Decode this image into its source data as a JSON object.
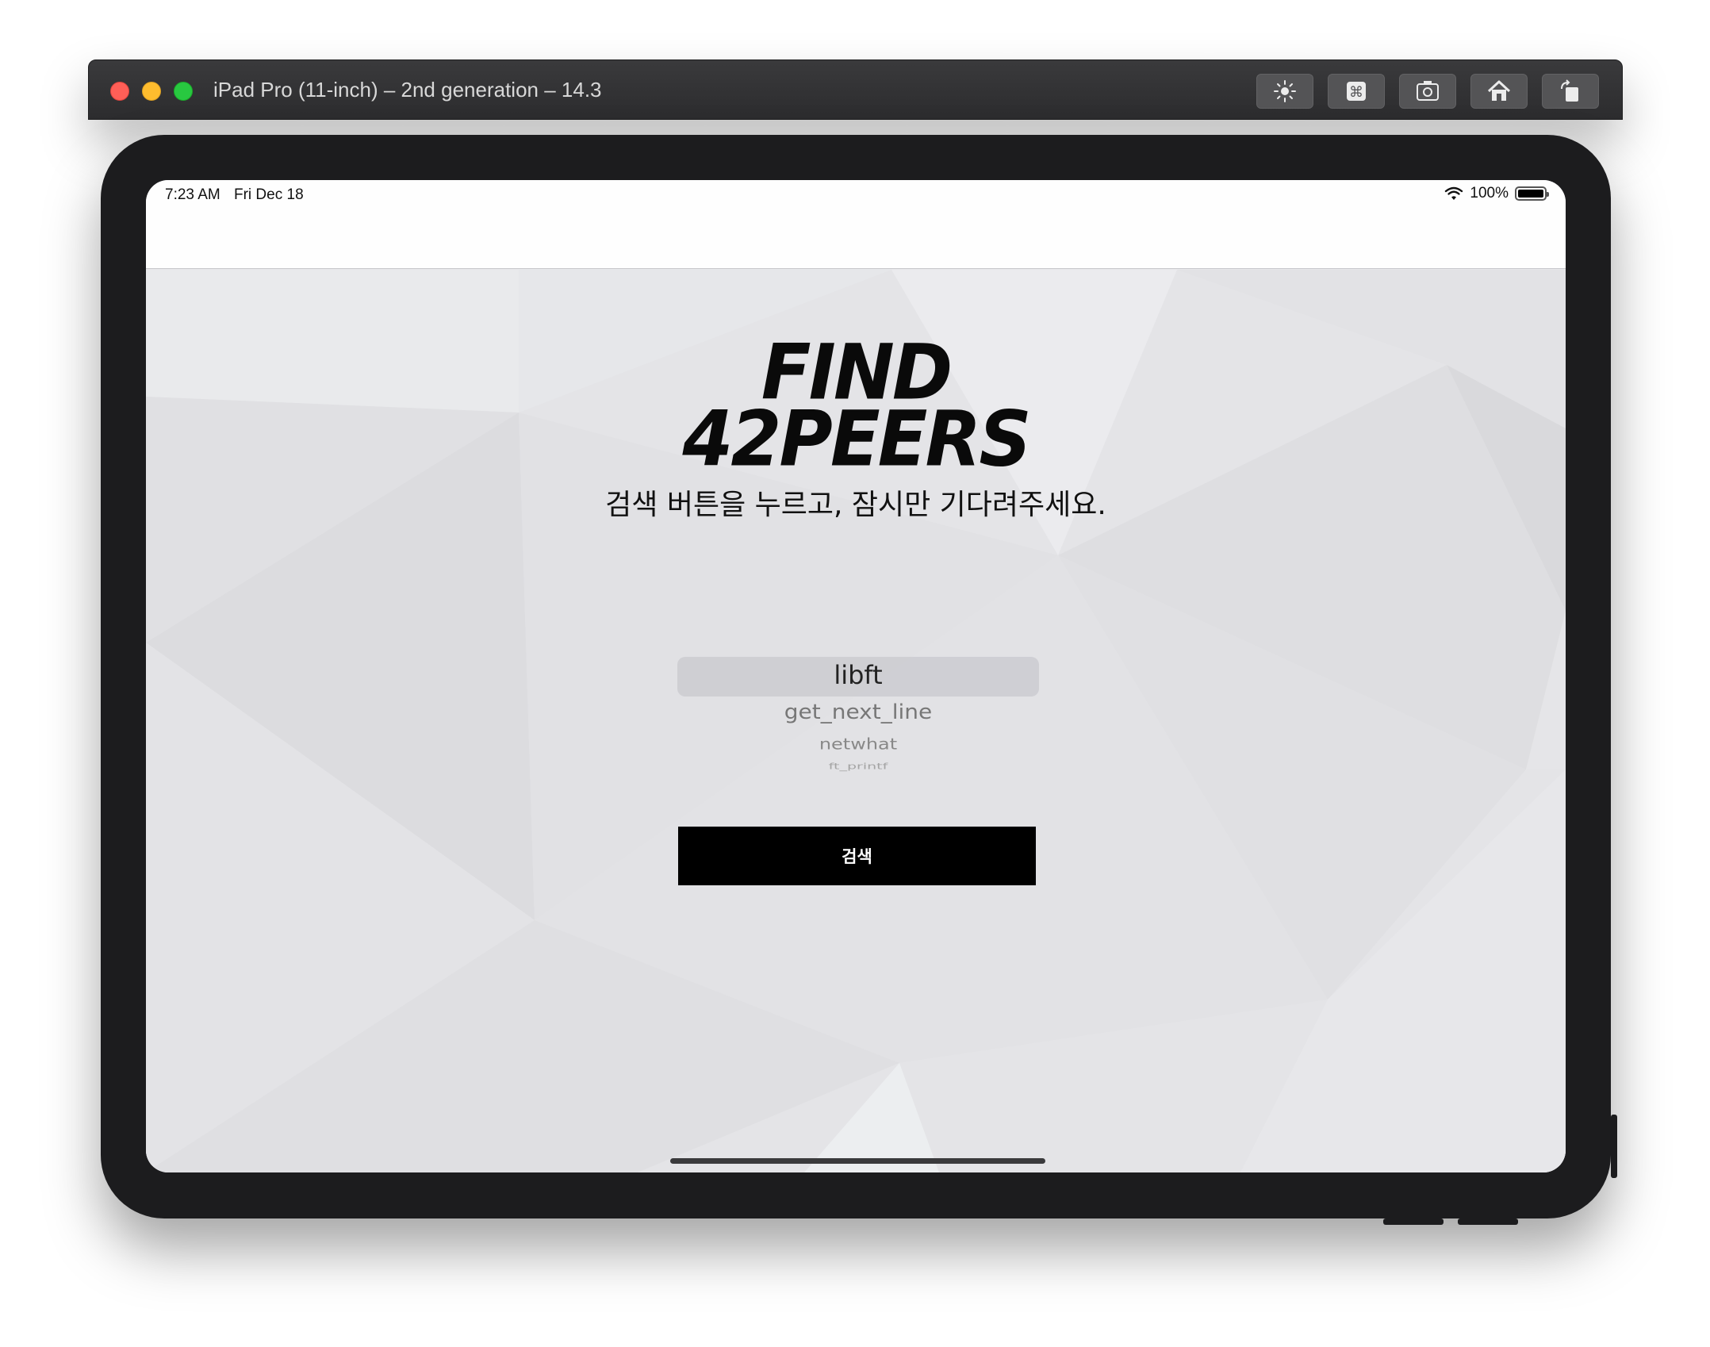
{
  "window": {
    "title": "iPad Pro (11-inch) – 2nd generation – 14.3",
    "toolbar": [
      {
        "name": "brightness-icon",
        "label": "Brightness"
      },
      {
        "name": "command-icon",
        "label": "⌘"
      },
      {
        "name": "screenshot-icon",
        "label": "Screenshot"
      },
      {
        "name": "home-icon",
        "label": "Home"
      },
      {
        "name": "rotate-icon",
        "label": "Rotate"
      }
    ]
  },
  "statusbar": {
    "time": "7:23 AM",
    "date": "Fri Dec 18",
    "battery": "100%",
    "battery_level": 1.0
  },
  "app": {
    "logo_line1": "FIND",
    "logo_line2": "42PEERS",
    "subtitle": "검색 버튼을 누르고, 잠시만 기다려주세요.",
    "picker": {
      "selected": "libft",
      "items": [
        "libft",
        "get_next_line",
        "netwhat",
        "ft_printf"
      ]
    },
    "search_button": "검색"
  },
  "colors": {
    "background": "#e6e6e9",
    "button": "#000000",
    "button_text": "#ffffff"
  }
}
